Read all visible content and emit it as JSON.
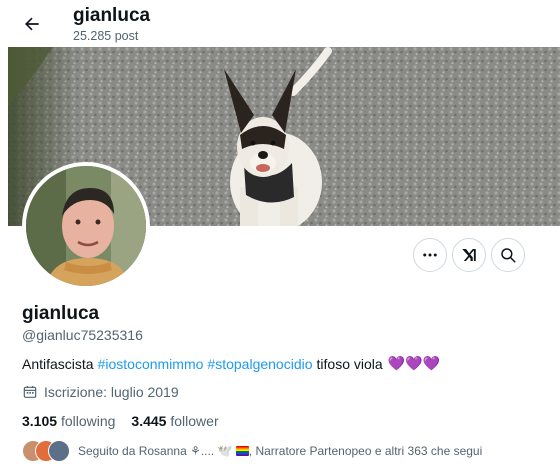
{
  "header": {
    "title": "gianluca",
    "post_count": "25.285 post",
    "back_icon": "arrow-left-icon"
  },
  "profile": {
    "display_name": "gianluca",
    "handle": "@gianluc75235316",
    "bio": {
      "prefix": "Antifascista",
      "hashtag1": "#iostoconmimmo",
      "hashtag2": "#stopalgenocidio",
      "suffix": "tifoso viola",
      "emoji": "💜💜💜"
    },
    "joined": "Iscrizione: luglio 2019",
    "following_count": "3.105",
    "following_label": "following",
    "followers_count": "3.445",
    "followers_label": "follower",
    "followed_by_prefix": "Seguito da Rosanna ⚘.... 🕊️",
    "followed_by_suffix": ", Narratore Partenopeo e altri 363 che segui"
  },
  "actions": {
    "more_icon": "more-icon",
    "grok_icon": "grok-icon",
    "search_icon": "search-icon"
  },
  "colors": {
    "accent": "#1d9bf0",
    "text_primary": "#0f1419",
    "text_secondary": "#536471",
    "border": "#cfd9de",
    "heart_purple": "#ab8ee0"
  }
}
